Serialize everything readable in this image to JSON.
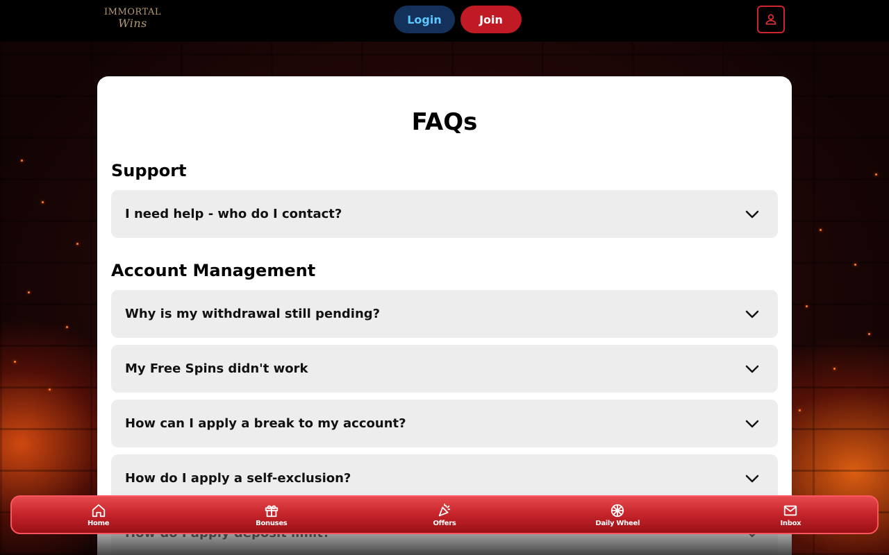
{
  "header": {
    "logo_line1": "IMMORTAL",
    "logo_line2": "Wins",
    "login_label": "Login",
    "join_label": "Join",
    "user_icon": "user-icon"
  },
  "main": {
    "title": "FAQs",
    "sections": [
      {
        "title": "Support",
        "items": [
          "I need help - who do I contact?"
        ]
      },
      {
        "title": "Account Management",
        "items": [
          "Why is my withdrawal still pending?",
          "My Free Spins didn't work",
          "How can I apply a break to my account?",
          "How do I apply a self-exclusion?",
          "How do I apply deposit limit?"
        ]
      }
    ]
  },
  "bottom_nav": {
    "items": [
      {
        "label": "Home",
        "icon": "home-icon"
      },
      {
        "label": "Bonuses",
        "icon": "gift-icon"
      },
      {
        "label": "Offers",
        "icon": "party-popper-icon"
      },
      {
        "label": "Daily Wheel",
        "icon": "wheel-icon"
      },
      {
        "label": "Inbox",
        "icon": "mail-icon"
      }
    ]
  },
  "colors": {
    "login_bg": "#14315b",
    "login_text": "#5cc8ff",
    "join_bg": "#c01a24",
    "nav_red": "#c8262c",
    "faq_bg": "#ededed"
  }
}
